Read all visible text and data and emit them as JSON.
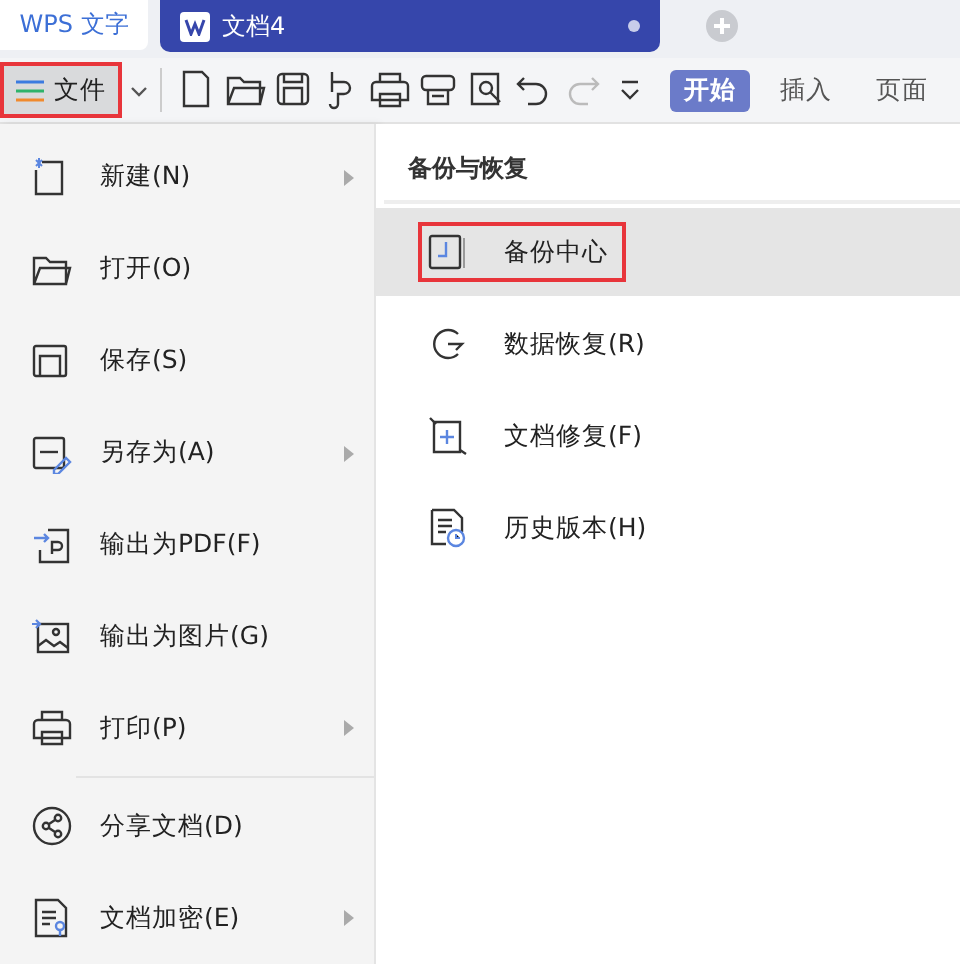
{
  "tabs": [
    {
      "label": "WPS 文字",
      "kind": "app",
      "selected": false
    },
    {
      "label": "文档4",
      "kind": "doc",
      "selected": true
    }
  ],
  "toolbar": {
    "file_button": {
      "label": "文件",
      "highlighted": true
    },
    "ribbon_tabs": [
      {
        "label": "开始",
        "selected": true
      },
      {
        "label": "插入",
        "selected": false
      },
      {
        "label": "页面",
        "selected": false
      }
    ]
  },
  "menu": {
    "groups": [
      [
        {
          "label": "新建(N)",
          "kind": "new",
          "submenu": true
        },
        {
          "label": "打开(O)",
          "kind": "open",
          "submenu": false
        },
        {
          "label": "保存(S)",
          "kind": "save",
          "submenu": false
        },
        {
          "label": "另存为(A)",
          "kind": "saveas",
          "submenu": true
        },
        {
          "label": "输出为PDF(F)",
          "kind": "pdf",
          "submenu": false
        },
        {
          "label": "输出为图片(G)",
          "kind": "image",
          "submenu": false
        },
        {
          "label": "打印(P)",
          "kind": "print",
          "submenu": true
        }
      ],
      [
        {
          "label": "分享文档(D)",
          "kind": "share",
          "submenu": false
        },
        {
          "label": "文档加密(E)",
          "kind": "encrypt",
          "submenu": true
        }
      ]
    ],
    "panel": {
      "title": "备份与恢复",
      "items": [
        {
          "label": "备份中心",
          "kind": "backup",
          "selected": true,
          "highlighted": true
        },
        {
          "label": "数据恢复(R)",
          "kind": "recover",
          "selected": false,
          "highlighted": false
        },
        {
          "label": "文档修复(F)",
          "kind": "repair",
          "selected": false,
          "highlighted": false
        },
        {
          "label": "历史版本(H)",
          "kind": "history",
          "selected": false,
          "highlighted": false
        }
      ]
    }
  }
}
